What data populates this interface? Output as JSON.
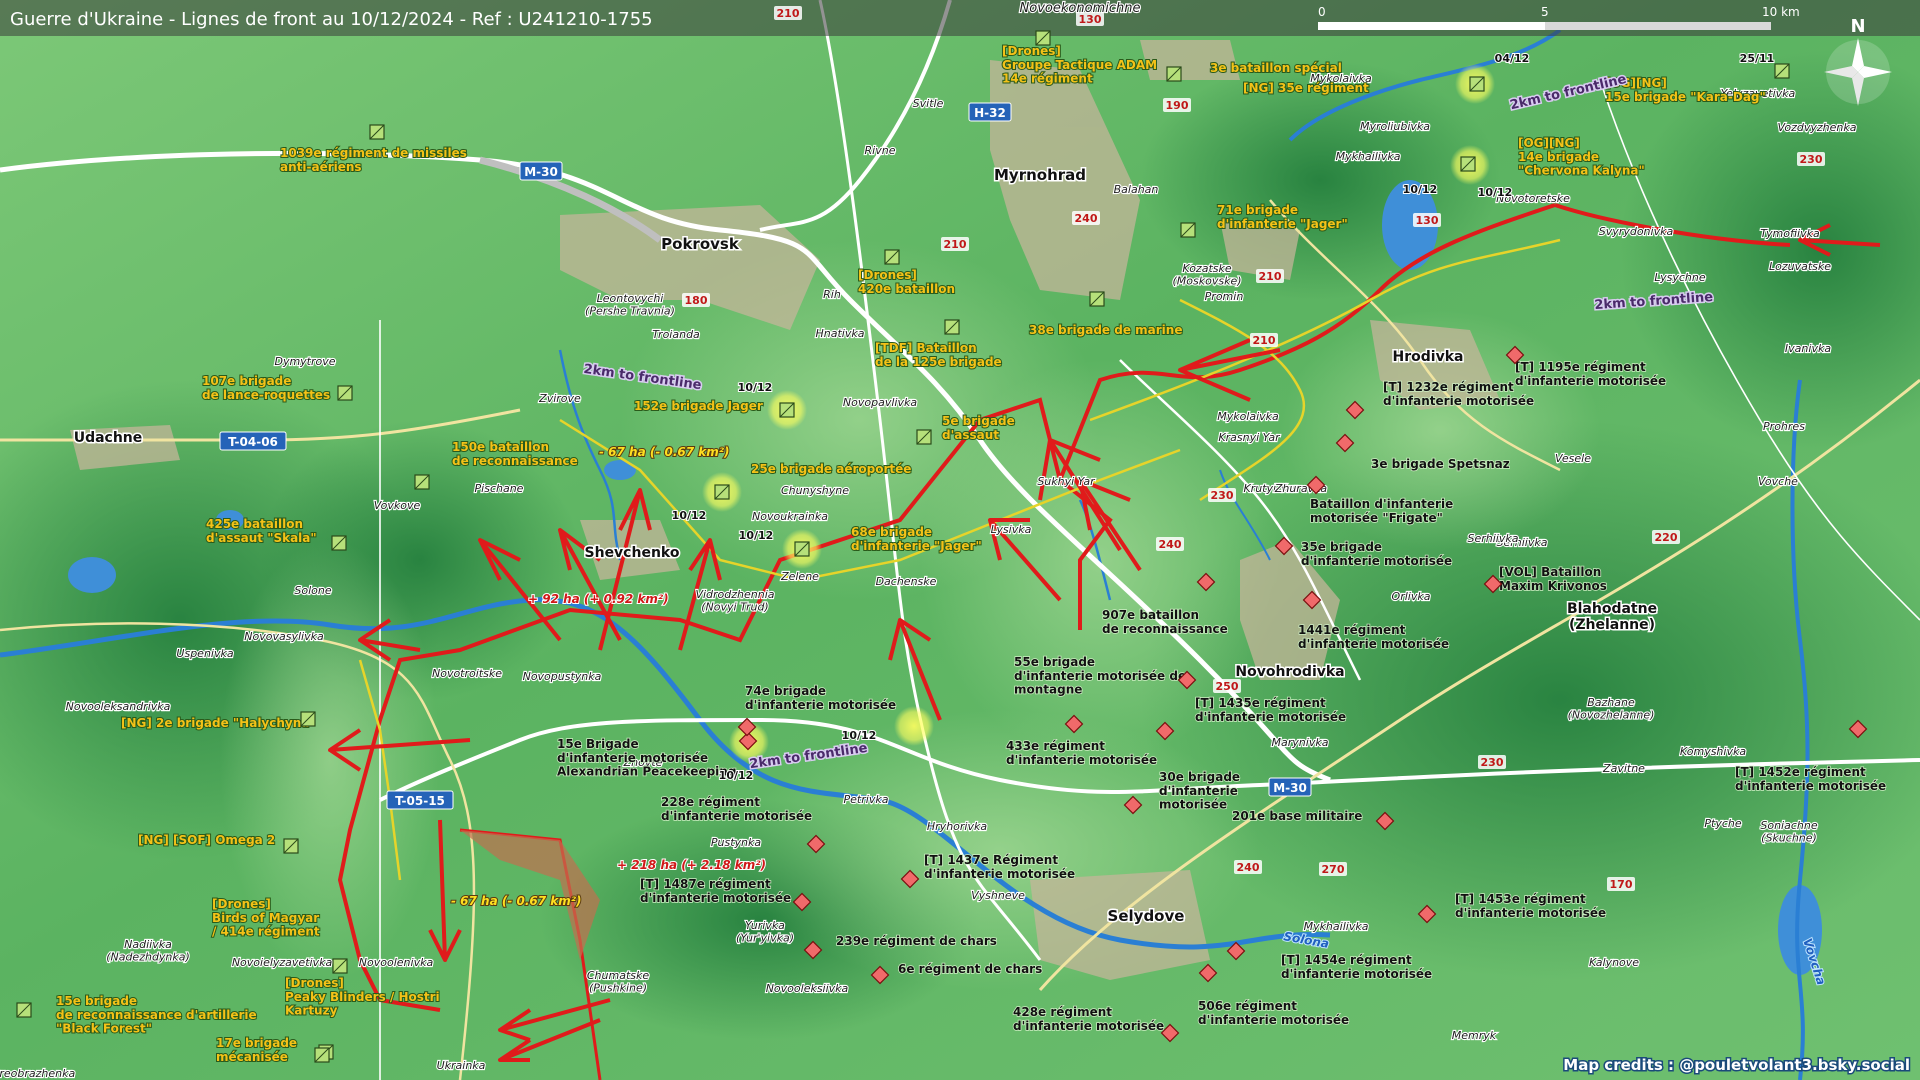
{
  "header": {
    "title": "Guerre d'Ukraine - Lignes de front au 10/12/2024 - Ref : U241210-1755",
    "scale_labels": [
      "0",
      "5",
      "10 km"
    ],
    "north_label": "N"
  },
  "credit": "Map credits : @pouletvolant3.bsky.social",
  "colors": {
    "terrain_light": "#6dbf6a",
    "terrain_dark": "#2e8a43",
    "front_red": "#e01b1b",
    "river": "#2a7fd4",
    "unit_label": "#f4c218",
    "town_fill": "#c9b89a"
  },
  "towns": [
    {
      "name": "Pokrovsk"
    },
    {
      "name": "Myrnohrad"
    },
    {
      "name": "Selydove"
    },
    {
      "name": "Novohrodivka"
    },
    {
      "name": "Hrodivka"
    },
    {
      "name": "Udachne"
    },
    {
      "name": "Shevchenko"
    },
    {
      "name": "Blahodatne\n(Zhelanne)"
    },
    {
      "name": "Novoekonomichne"
    },
    {
      "name": "Dymytrove"
    },
    {
      "name": "Zvirove"
    },
    {
      "name": "Vovkove"
    },
    {
      "name": "Pischane"
    },
    {
      "name": "Solone"
    },
    {
      "name": "Novovasylivka"
    },
    {
      "name": "Uspenivka"
    },
    {
      "name": "Novooleksandrivka"
    },
    {
      "name": "Novotroitske"
    },
    {
      "name": "Novopustynka"
    },
    {
      "name": "Zhovte"
    },
    {
      "name": "Vidrodzhennia\n(Novyi Trud)"
    },
    {
      "name": "Zelene"
    },
    {
      "name": "Dachenske"
    },
    {
      "name": "Chunyshyne"
    },
    {
      "name": "Novoukrainka"
    },
    {
      "name": "Lysivka"
    },
    {
      "name": "Sukhyi Yar"
    },
    {
      "name": "Novopavlivka"
    },
    {
      "name": "Hnativka"
    },
    {
      "name": "Rih"
    },
    {
      "name": "Troianda"
    },
    {
      "name": "Leontovychi\n(Pershe Travnia)"
    },
    {
      "name": "Svitle"
    },
    {
      "name": "Rivne"
    },
    {
      "name": "Balahan"
    },
    {
      "name": "Kozatske\n(Moskovske)"
    },
    {
      "name": "Promin"
    },
    {
      "name": "Mykolaivka"
    },
    {
      "name": "Krasnyi Yar"
    },
    {
      "name": "Krutyi Yar"
    },
    {
      "name": "Zhuravka"
    },
    {
      "name": "Orlivka"
    },
    {
      "name": "Serhiivka"
    },
    {
      "name": "Vesele"
    },
    {
      "name": "Prohres"
    },
    {
      "name": "Vovche"
    },
    {
      "name": "Ivanivka"
    },
    {
      "name": "Lysychne"
    },
    {
      "name": "Svyrydonivka"
    },
    {
      "name": "Novotoretske"
    },
    {
      "name": "Tymofiivka"
    },
    {
      "name": "Lozuvatske"
    },
    {
      "name": "Yelyzavetivka"
    },
    {
      "name": "Vozdvyzhenka"
    },
    {
      "name": "Myroliubivka"
    },
    {
      "name": "Mykhailivka"
    },
    {
      "name": "Mykolaivka"
    },
    {
      "name": "Petrivka"
    },
    {
      "name": "Hryhorivka"
    },
    {
      "name": "Pustynka"
    },
    {
      "name": "Vyshneve"
    },
    {
      "name": "Yurivka\n(Yur'yivka)"
    },
    {
      "name": "Novooleksiivka"
    },
    {
      "name": "Chumatske\n(Pushkine)"
    },
    {
      "name": "Novoolenivka"
    },
    {
      "name": "Novoielyzavetivka"
    },
    {
      "name": "Nadiivka\n(Nadezhdynka)"
    },
    {
      "name": "Ukrainka"
    },
    {
      "name": "Marynivka"
    },
    {
      "name": "Bazhane\n(Novozhelanne)"
    },
    {
      "name": "Komyshivka"
    },
    {
      "name": "Zavitne"
    },
    {
      "name": "Ptyche"
    },
    {
      "name": "Soniachne\n(Skuchne)"
    },
    {
      "name": "Kalynove"
    },
    {
      "name": "Memryk"
    },
    {
      "name": "Mykhailivka"
    },
    {
      "name": "Novooleksandrivka"
    },
    {
      "name": "Serhiivka"
    },
    {
      "name": "Preobrazhenka"
    }
  ],
  "road_badges": [
    "M-30",
    "H-32",
    "T-04-06",
    "T-05-15",
    "M-30"
  ],
  "road_numbers": [
    "210",
    "130",
    "190",
    "180",
    "240",
    "210",
    "210",
    "210",
    "230",
    "240",
    "250",
    "270",
    "240",
    "230",
    "220",
    "170",
    "230",
    "130"
  ],
  "river_labels": [
    "Solona",
    "Vovcha"
  ],
  "frontline_notes": [
    "2km to frontline",
    "2km to frontline",
    "2km to frontline",
    "2km to frontline"
  ],
  "area_changes": [
    "- 67 ha (- 0.67 km²)",
    "+ 92 ha (+ 0.92 km²)",
    "+ 218 ha (+ 2.18 km²)",
    "- 67 ha (- 0.67 km²)"
  ],
  "dates": [
    "10/12",
    "10/12",
    "10/12",
    "10/12",
    "10/12",
    "10/12",
    "04/12",
    "25/11",
    "10/12"
  ],
  "ukr_units": [
    "[Drones]\nGroupe Tactique ADAM\n14e régiment",
    "3e bataillon spécial",
    "[NG] 35e régiment",
    "[OG][NG]\n15e brigade \"Kara-Dag\"",
    "[OG][NG]\n14e brigade\n\"Chervona Kalyna\"",
    "1039e régiment de missiles\nanti-aériens",
    "71e brigade\nd'infanterie \"Jager\"",
    "[Drones]\n420e bataillon",
    "[TDF] Bataillon\nde la 125e brigade",
    "38e brigade de marine",
    "107e brigade\nde lance-roquettes",
    "152e brigade Jager",
    "5e brigade\nd'assaut",
    "150e bataillon\nde reconnaissance",
    "25e brigade aéroportée",
    "425e bataillon\nd'assaut \"Skala\"",
    "68e brigade\nd'infanterie \"Jager\"",
    "[NG] 2e brigade \"Halychyna\"",
    "[NG] [SOF] Omega 2",
    "[Drones]\nBirds of Magyar\n/ 414e régiment",
    "[Drones]\nPeaky Blinders / Hostri\nKartuzy",
    "15e brigade\nde reconnaissance d'artillerie\n\"Black Forest\"",
    "17e brigade\nmécanisée"
  ],
  "ru_units": [
    "[T] 1195e régiment\nd'infanterie motorisée",
    "[T] 1232e régiment\nd'infanterie motorisée",
    "3e brigade Spetsnaz",
    "Bataillon d'infanterie\nmotorisée \"Frigate\"",
    "35e brigade\nd'infanterie motorisée",
    "[VOL] Bataillon\nMaxim Krivonos",
    "907e bataillon\nde reconnaissance",
    "1441e régiment\nd'infanterie motorisée",
    "55e brigade\nd'infanterie motorisée de\nmontagne",
    "[T] 1435e régiment\nd'infanterie motorisée",
    "74e brigade\nd'infanterie motorisée",
    "15e Brigade\nd'infanterie motorisée\nAlexandrian Peacekeeping",
    "433e régiment\nd'infanterie motorisée",
    "30e brigade\nd'infanterie\nmotorisée",
    "201e base militaire",
    "[T] 1452e régiment\nd'infanterie motorisée",
    "228e régiment\nd'infanterie motorisée",
    "[T] 1437e Régiment\nd'infanterie motorisée",
    "[T] 1487e régiment\nd'infanterie motorisée",
    "239e régiment de chars",
    "6e régiment de chars",
    "[T] 1453e régiment\nd'infanterie motorisée",
    "[T] 1454e régiment\nd'infanterie motorisée",
    "506e régiment\nd'infanterie motorisée",
    "428e régiment\nd'infanterie motorisée"
  ]
}
